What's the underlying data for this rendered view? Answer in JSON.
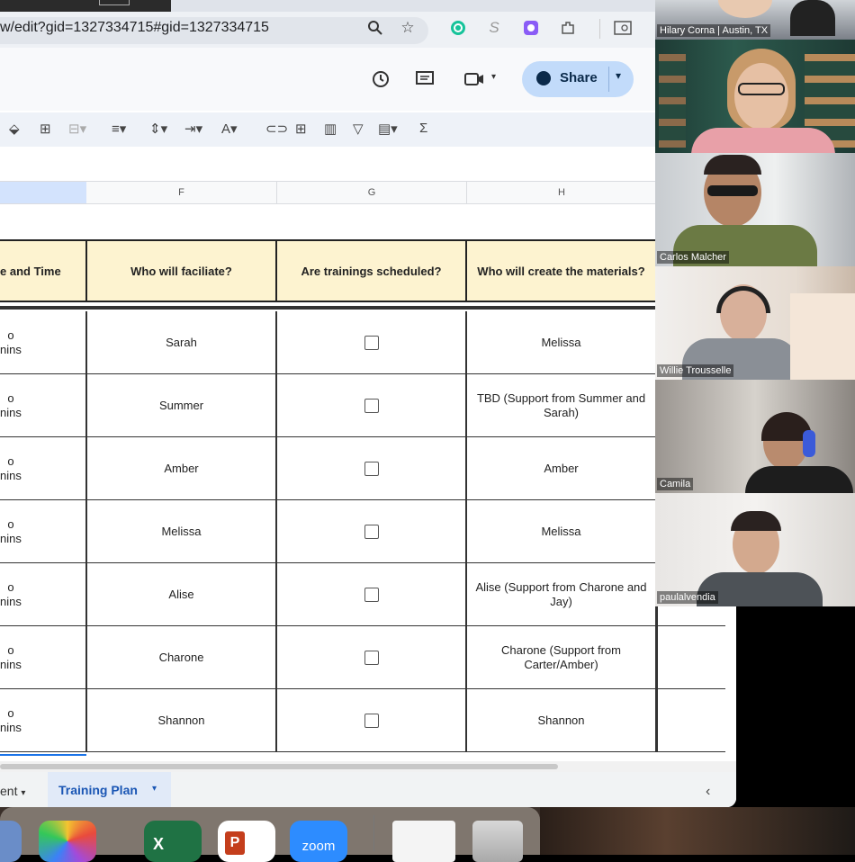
{
  "browser": {
    "url": "w/edit?gid=1327334715#gid=1327334715",
    "share_label": "Share"
  },
  "columns": [
    "F",
    "G",
    "H"
  ],
  "headers": {
    "e": "e and Time",
    "f": "Who will faciliate?",
    "g": "Are trainings scheduled?",
    "h": "Who will create the materials?"
  },
  "rows": [
    {
      "e": [
        "o",
        "nins"
      ],
      "facilitator": "Sarah",
      "materials": "Melissa"
    },
    {
      "e": [
        "o",
        "nins"
      ],
      "facilitator": "Summer",
      "materials": "TBD (Support from Summer and Sarah)"
    },
    {
      "e": [
        "o",
        "nins"
      ],
      "facilitator": "Amber",
      "materials": "Amber"
    },
    {
      "e": [
        "o",
        "nins"
      ],
      "facilitator": "Melissa",
      "materials": "Melissa"
    },
    {
      "e": [
        "o",
        "nins"
      ],
      "facilitator": "Alise",
      "materials": "Alise (Support from Charone and Jay)"
    },
    {
      "e": [
        "o",
        "nins"
      ],
      "facilitator": "Charone",
      "materials": "Charone (Support from Carter/Amber)"
    },
    {
      "e": [
        "o",
        "nins"
      ],
      "facilitator": "Shannon",
      "materials": "Shannon"
    }
  ],
  "sheets": {
    "prev_partial": "ent",
    "active": "Training Plan"
  },
  "participants": [
    {
      "name": "Hilary Corna | Austin, TX"
    },
    {
      "name": ""
    },
    {
      "name": "Carlos Malcher"
    },
    {
      "name": "Willie Trousselle"
    },
    {
      "name": "Camila"
    },
    {
      "name": "paulalvendia"
    }
  ],
  "dock": {
    "zoom_label": "zoom",
    "excel_letter": "X",
    "ppt_letter": "P"
  }
}
